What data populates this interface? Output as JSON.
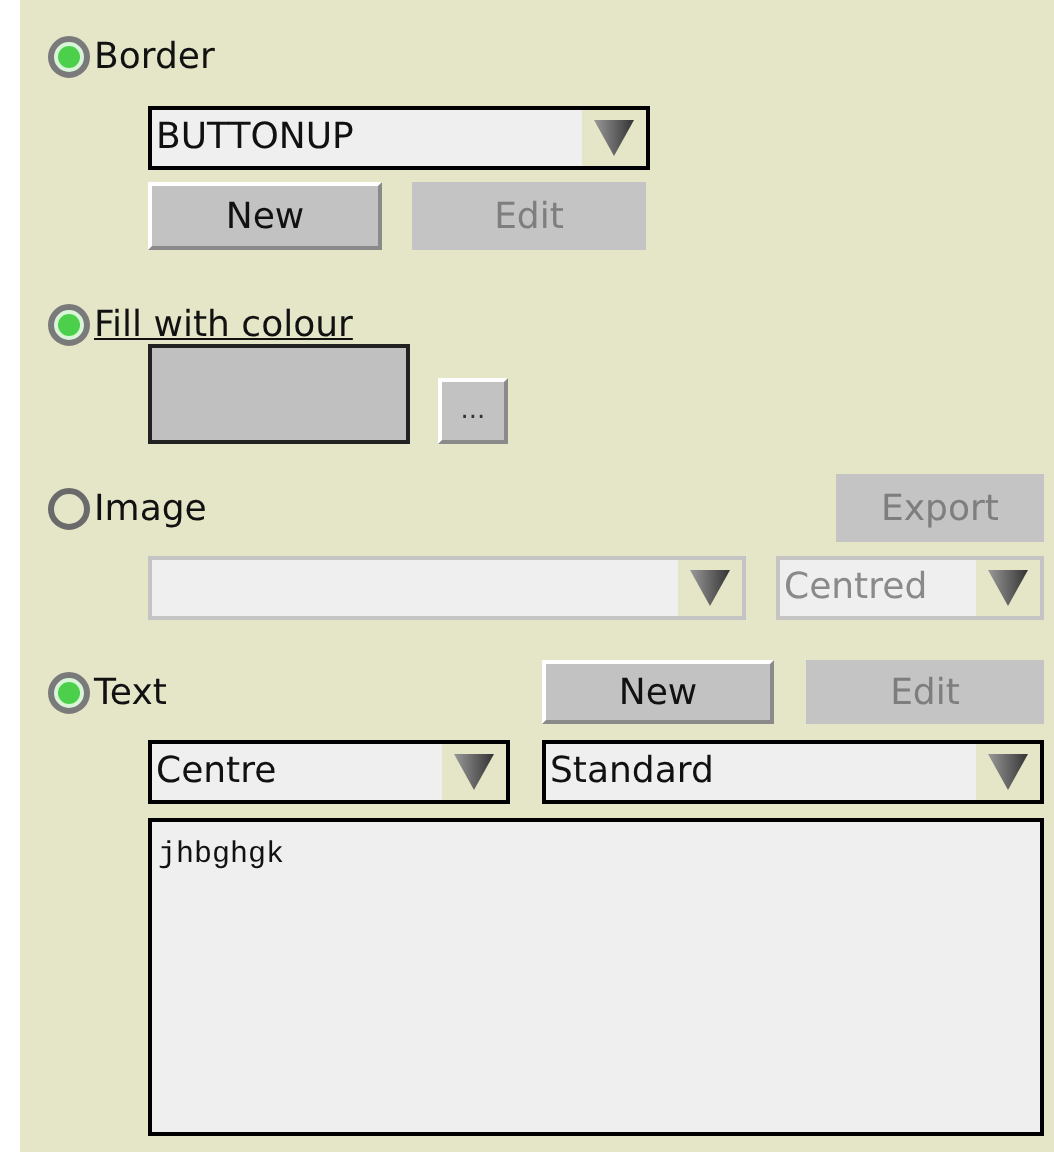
{
  "border": {
    "label": "Border",
    "on": true,
    "dropdown": {
      "value": "BUTTONUP",
      "disabled": false
    },
    "buttons": [
      {
        "label": "New",
        "disabled": false
      },
      {
        "label": "Edit",
        "disabled": true
      }
    ]
  },
  "fill": {
    "label": "Fill with colour",
    "on": true,
    "focused": true,
    "picker_button": {
      "label": "..."
    }
  },
  "image": {
    "label": "Image",
    "on": false,
    "export_button": {
      "label": "Export",
      "disabled": true
    },
    "file_dropdown": {
      "disabled": true
    },
    "placement_dropdown": {
      "value": "Centred",
      "disabled": true
    }
  },
  "text": {
    "label": "Text",
    "on": true,
    "buttons": [
      {
        "label": "New",
        "disabled": false
      },
      {
        "label": "Edit",
        "disabled": true
      }
    ],
    "align_dropdown": {
      "value": "Centre",
      "disabled": false
    },
    "style_dropdown": {
      "value": "Standard",
      "disabled": false
    },
    "content": "jhbghgk"
  }
}
